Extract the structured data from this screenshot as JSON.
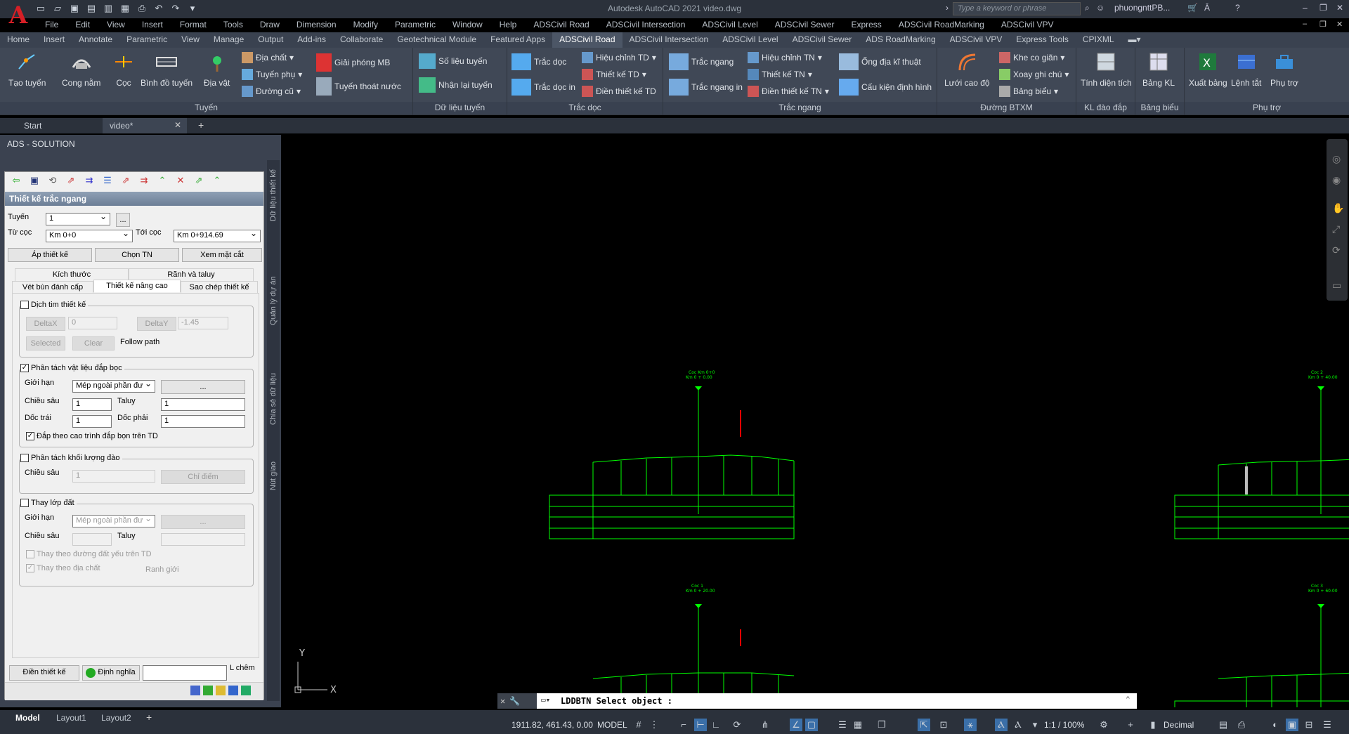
{
  "app": {
    "title": "Autodesk AutoCAD 2021    video.dwg",
    "logo_letter": "A",
    "search_placeholder": "Type a keyword or phrase",
    "user": "phuongnttPB..."
  },
  "menus": [
    "File",
    "Edit",
    "View",
    "Insert",
    "Format",
    "Tools",
    "Draw",
    "Dimension",
    "Modify",
    "Parametric",
    "Window",
    "Help",
    "ADSCivil Road",
    "ADSCivil Intersection",
    "ADSCivil Level",
    "ADSCivil Sewer",
    "Express",
    "ADSCivil RoadMarking",
    "ADSCivil VPV"
  ],
  "ribbon_tabs": [
    "Home",
    "Insert",
    "Annotate",
    "Parametric",
    "View",
    "Manage",
    "Output",
    "Add-ins",
    "Collaborate",
    "Geotechnical Module",
    "Featured Apps",
    "ADSCivil Road",
    "ADSCivil Intersection",
    "ADSCivil Level",
    "ADSCivil Sewer",
    "ADS RoadMarking",
    "ADSCivil VPV",
    "Express Tools",
    "CPIXML"
  ],
  "ribbon_active_tab": "ADSCivil Road",
  "ribbon": {
    "tuyen": {
      "label": "Tuyến",
      "tao_tuyen": "Tạo tuyến",
      "cong_nam": "Cong nằm",
      "coc": "Cọc",
      "binh_do": "Bình đồ tuyến",
      "dia_vat": "Địa vật",
      "dia_chat": "Địa chất",
      "tuyen_phu": "Tuyến phụ",
      "duong_cu": "Đường cũ",
      "giai_phong": "Giải phóng MB",
      "thoat_nuoc": "Tuyến thoát nước"
    },
    "du_lieu": {
      "label": "Dữ liệu tuyến",
      "so_lieu": "Số liệu tuyến",
      "nhan_lai": "Nhận lại tuyến"
    },
    "trac_doc": {
      "label": "Trắc dọc",
      "trac_doc": "Trắc dọc",
      "trac_doc_in": "Trắc dọc in",
      "hieu_chinh": "Hiệu chỉnh TD",
      "thiet_ke": "Thiết kế TD",
      "dien_tk": "Điền thiết kế TD"
    },
    "trac_ngang": {
      "label": "Trắc ngang",
      "trac_ngang": "Trắc ngang",
      "trac_ngang_in": "Trắc ngang in",
      "hieu_chinh": "Hiệu chỉnh TN",
      "thiet_ke": "Thiết kế TN",
      "dien_tk": "Điền thiết kế TN",
      "ong": "Ống địa kĩ thuật",
      "cau_kien": "Cấu kiện định hình"
    },
    "btxm": {
      "label": "Đường BTXM",
      "luoi": "Lưới cao độ",
      "khe": "Khe co giãn",
      "xoay": "Xoay ghi chú",
      "bang_bieu": "Bảng biểu"
    },
    "kl": {
      "label": "KL đào đắp",
      "tinh": "Tính diện tích"
    },
    "bang_bieu": {
      "label": "Bảng biểu",
      "bang_kl": "Bảng KL"
    },
    "phu_tro": {
      "label": "Phụ trợ",
      "xuat": "Xuất bảng",
      "lenh_tat": "Lệnh tắt",
      "phu_tro": "Phụ trợ"
    }
  },
  "doc_tabs": {
    "start": "Start",
    "video": "video*"
  },
  "palette": {
    "title": "ADS - SOLUTION",
    "vtabs": [
      "Dữ liệu thiết kế",
      "Quản lý dự án",
      "Chia sẻ dữ liệu",
      "Nút giao"
    ],
    "form": {
      "header": "Thiết kế trắc ngang",
      "tuyen_label": "Tuyến",
      "tuyen_value": "1",
      "browse": "...",
      "tu_coc_label": "Từ cọc",
      "tu_coc_value": "Km 0+0",
      "toi_coc_label": "Tới cọc",
      "toi_coc_value": "Km 0+914.69",
      "btn_ap": "Áp thiết kế",
      "btn_chon": "Chọn TN",
      "btn_xem": "Xem mặt cắt",
      "tabs_row1": [
        "Kích thước",
        "Rãnh và taluy"
      ],
      "tabs_row2": [
        "Vét bùn đánh cấp",
        "Thiết kế nâng cao",
        "Sao chép thiết kế"
      ],
      "dich_tim": "Dịch tim thiết kế",
      "deltax": "DeltaX",
      "deltax_val": "0",
      "deltay": "DeltaY",
      "deltay_val": "-1.45",
      "selected": "Selected",
      "clear": "Clear",
      "follow": "Follow path",
      "phan_tach": "Phân tách vật liệu đắp bọc",
      "gioi_han": "Giới hạn",
      "gioi_han_val": "Mép ngoài phần đư",
      "dots": "...",
      "chieu_sau": "Chiều sâu",
      "chieu_sau_val": "1",
      "taluy": "Taluy",
      "taluy_val": "1",
      "doc_trai": "Dốc trái",
      "doc_trai_val": "1",
      "doc_phai": "Dốc phải",
      "doc_phai_val": "1",
      "dap_theo": "Đắp theo cao trình đắp bọn trên TD",
      "khoi_luong": "Phân tách khối lượng đào",
      "ks_chieu_sau": "Chiều sâu",
      "ks_val": "1",
      "chi_diem": "Chỉ điểm",
      "thay_lop": "Thay lớp đất",
      "tl_gioi_han": "Giới hạn",
      "tl_gioi_han_val": "Mép ngoài phần đư",
      "tl_chieu_sau": "Chiều sâu",
      "tl_taluy": "Taluy",
      "thay_duong": "Thay theo đường đất yếu trên TD",
      "thay_dia_chat": "Thay theo địa chất",
      "ranh_gioi": "Ranh giới",
      "btn_dien": "Điền thiết kế",
      "btn_dinh_nghia": "Định nghĩa",
      "l_chem": "L chêm"
    }
  },
  "drawing": {
    "sections": [
      {
        "label1": "Coc Km 0+0",
        "label2": "Km 0 + 0.00"
      },
      {
        "label1": "Coc 2",
        "label2": "Km 0 + 40.00"
      },
      {
        "label1": "Coc 1",
        "label2": "Km 0 + 20.00"
      },
      {
        "label1": "Coc 3",
        "label2": "Km 0 + 60.00"
      }
    ]
  },
  "command": {
    "text": "LDDBTN Select object :"
  },
  "status": {
    "layouts": [
      "Model",
      "Layout1",
      "Layout2"
    ],
    "coords": "1911.82, 461.43, 0.00",
    "model": "MODEL",
    "scale": "1:1 / 100%",
    "units": "Decimal"
  }
}
